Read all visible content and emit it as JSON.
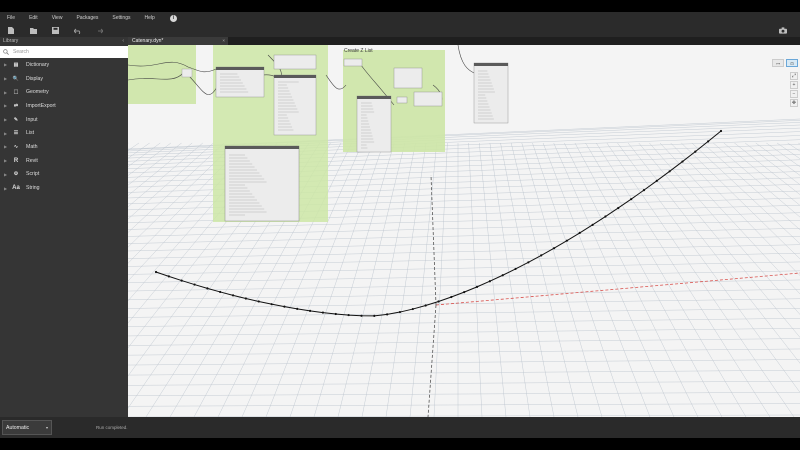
{
  "menu": [
    "File",
    "Edit",
    "View",
    "Packages",
    "Settings",
    "Help"
  ],
  "info_icon": "i",
  "toolbar_icons": [
    "new-file-icon",
    "open-folder-icon",
    "save-icon",
    "undo-icon",
    "redo-icon",
    "camera-icon"
  ],
  "library": {
    "title": "Library",
    "search_placeholder": "Search",
    "items": [
      {
        "label": "Dictionary",
        "icon": "dictionary-icon"
      },
      {
        "label": "Display",
        "icon": "display-icon"
      },
      {
        "label": "Geometry",
        "icon": "geometry-icon"
      },
      {
        "label": "ImportExport",
        "icon": "import-export-icon"
      },
      {
        "label": "Input",
        "icon": "input-icon"
      },
      {
        "label": "List",
        "icon": "list-icon"
      },
      {
        "label": "Math",
        "icon": "math-icon"
      },
      {
        "label": "Revit",
        "icon": "revit-icon",
        "glyph": "R"
      },
      {
        "label": "Script",
        "icon": "script-icon"
      },
      {
        "label": "String",
        "icon": "string-icon",
        "glyph": "Aa"
      }
    ]
  },
  "tab": {
    "label": "Catenary.dyn*",
    "close": "×"
  },
  "groups": {
    "create_list_title": "Create Z List"
  },
  "run": {
    "mode": "Automatic",
    "status": "Run completed."
  },
  "colors": {
    "group_green": "#cde6a6",
    "curve": "#111111",
    "grid": "#b9c2cc",
    "axis_x": "#d9534f"
  }
}
